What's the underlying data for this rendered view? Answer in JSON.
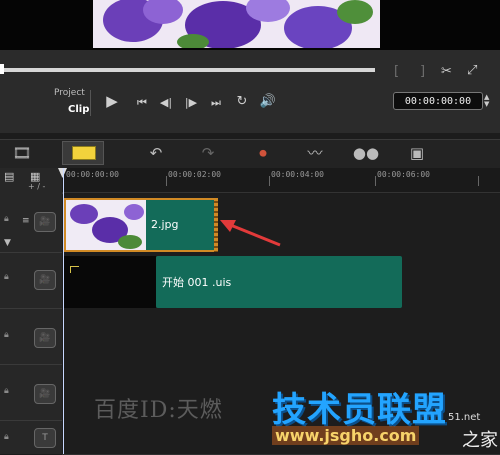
{
  "player": {
    "project_label": "Project",
    "clip_label": "Clip",
    "timecode": "00:00:00:00",
    "progress_fraction": 0.0,
    "mark_in": "[",
    "mark_out": "]"
  },
  "timeline": {
    "ruler_labels": [
      "00:00:00:00",
      "00:00:02:00",
      "00:00:04:00",
      "00:00:06:00"
    ],
    "zoom_label": "+ / -",
    "tracks": {
      "video_clip_label": "2.jpg",
      "title_clip_label": "开始 001 .uis"
    }
  },
  "watermarks": {
    "baidu": "百度ID:天燃",
    "brand": "技术员联盟",
    "url": "www.jsgho.com",
    "tail1": "51.net",
    "tail2": "之家"
  },
  "colors": {
    "clip_teal": "#136b59",
    "clip_border": "#d18a25",
    "arrow_red": "#e23a3a"
  }
}
